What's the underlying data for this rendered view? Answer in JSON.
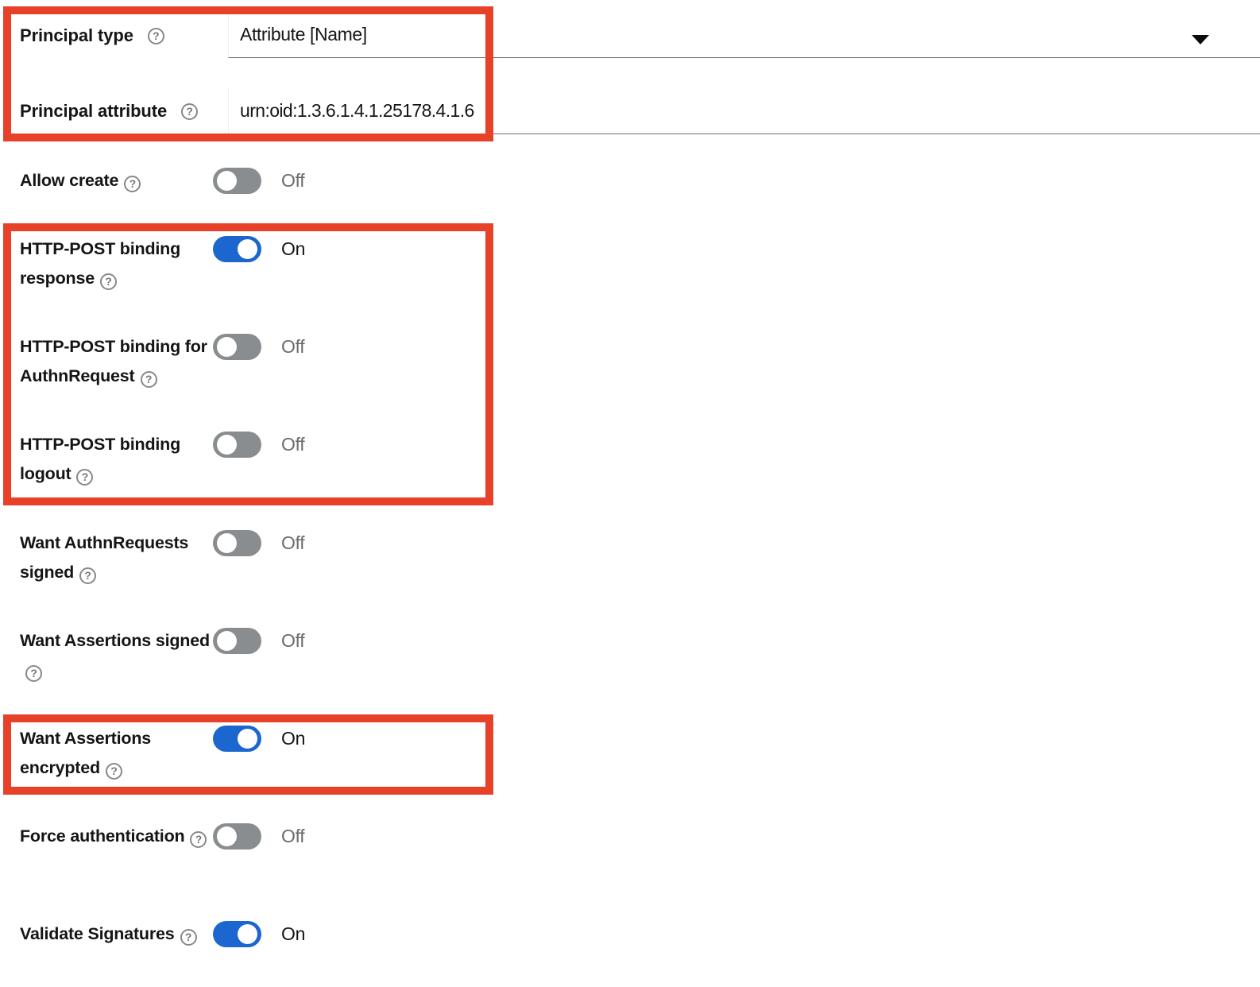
{
  "form": {
    "rows": [
      {
        "label": "Principal type",
        "help": "?",
        "value": "Attribute [Name]",
        "control": "select"
      },
      {
        "label": "Principal attribute",
        "help": "?",
        "value": "urn:oid:1.3.6.1.4.1.25178.4.1.6",
        "control": "text"
      }
    ]
  },
  "toggles": [
    {
      "label": "Allow create",
      "help": "?",
      "state": "Off",
      "on": false
    },
    {
      "label": "HTTP-POST binding response",
      "help": "?",
      "state": "On",
      "on": true
    },
    {
      "label": "HTTP-POST binding for AuthnRequest",
      "help": "?",
      "state": "Off",
      "on": false
    },
    {
      "label": "HTTP-POST binding logout",
      "help": "?",
      "state": "Off",
      "on": false
    },
    {
      "label": "Want AuthnRequests signed",
      "help": "?",
      "state": "Off",
      "on": false
    },
    {
      "label": "Want Assertions signed",
      "help": "?",
      "state": "Off",
      "on": false
    },
    {
      "label": "Want Assertions encrypted",
      "help": "?",
      "state": "On",
      "on": true
    },
    {
      "label": "Force authentication",
      "help": "?",
      "state": "Off",
      "on": false
    },
    {
      "label": "Validate Signatures",
      "help": "?",
      "state": "On",
      "on": true
    }
  ],
  "annotations": {
    "highlight_color": "#e8412a",
    "boxes": [
      {
        "name": "principal-fields-highlight"
      },
      {
        "name": "http-post-bindings-highlight"
      },
      {
        "name": "want-assertions-encrypted-highlight"
      }
    ]
  },
  "colors": {
    "toggle_on": "#1b66cf",
    "toggle_off": "#8a8d8f",
    "highlight": "#e8412a",
    "label_text": "#151515",
    "off_text": "#6b6b6b"
  }
}
